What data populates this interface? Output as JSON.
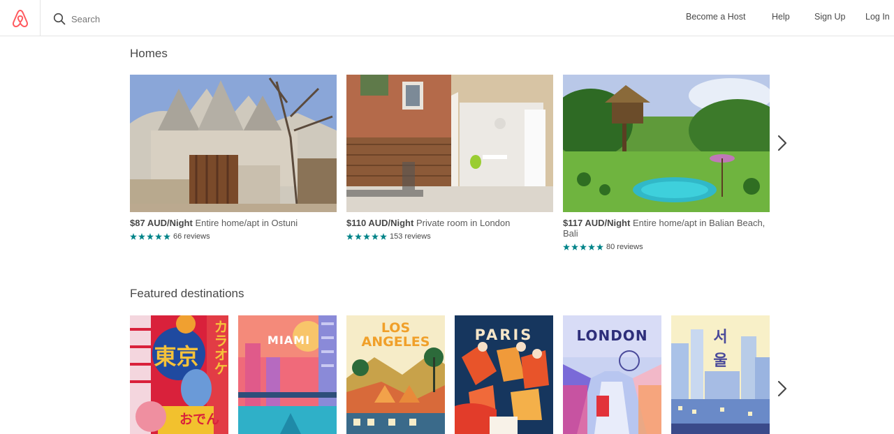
{
  "header": {
    "search_placeholder": "Search",
    "nav": [
      "Become a Host",
      "Help",
      "Sign Up",
      "Log In"
    ]
  },
  "homes": {
    "title": "Homes",
    "listings": [
      {
        "price": "$87 AUD/Night",
        "description": "Entire home/apt in Ostuni",
        "rating": 5,
        "reviews": "66 reviews"
      },
      {
        "price": "$110 AUD/Night",
        "description": "Private room in London",
        "rating": 5,
        "reviews": "153 reviews"
      },
      {
        "price": "$117 AUD/Night",
        "description": "Entire home/apt in Balian Beach, Bali",
        "rating": 5,
        "reviews": "80 reviews"
      }
    ]
  },
  "destinations": {
    "title": "Featured destinations",
    "posters": [
      {
        "label": "東京",
        "side": "カラオケ",
        "bottom": "おでん"
      },
      {
        "label": "MIAMI"
      },
      {
        "label_line1": "LOS",
        "label_line2": "ANGELES"
      },
      {
        "label": "PARIS"
      },
      {
        "label": "LONDON"
      },
      {
        "label_line1": "서",
        "label_line2": "울"
      }
    ]
  },
  "colors": {
    "brand": "#FF5A5F",
    "star": "#008489",
    "text": "#484848"
  }
}
